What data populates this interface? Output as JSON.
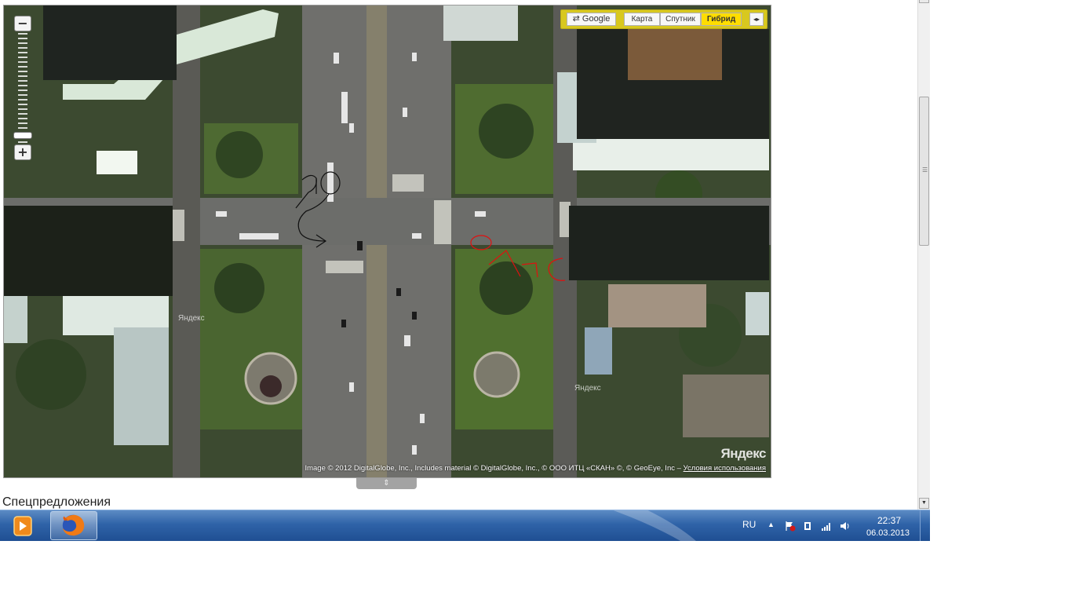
{
  "map": {
    "zoom_in": "+",
    "zoom_out": "−",
    "layers": {
      "google": "Google",
      "map": "Карта",
      "satellite": "Спутник",
      "hybrid": "Гибрид",
      "active": "Гибрид"
    },
    "watermark": "Яндекс",
    "logo": "Яндекс",
    "copyright": "Image © 2012 DigitalGlobe, Inc., Includes material © DigitalGlobe, Inc., © ООО ИТЦ «СКАН» ©, © GeoEye, Inc –",
    "terms_link": "Условия использования",
    "drawing": {
      "black_annotation_color": "#111111",
      "red_annotation_color": "#e01010"
    }
  },
  "page": {
    "section_title": "Спецпредложения"
  },
  "taskbar": {
    "language": "RU",
    "time": "22:37",
    "date": "06.03.2013"
  },
  "colors": {
    "taskbar": "#2f63a8",
    "hybrid_active": "#ffdd00",
    "toolbar": "#d8c81f"
  }
}
